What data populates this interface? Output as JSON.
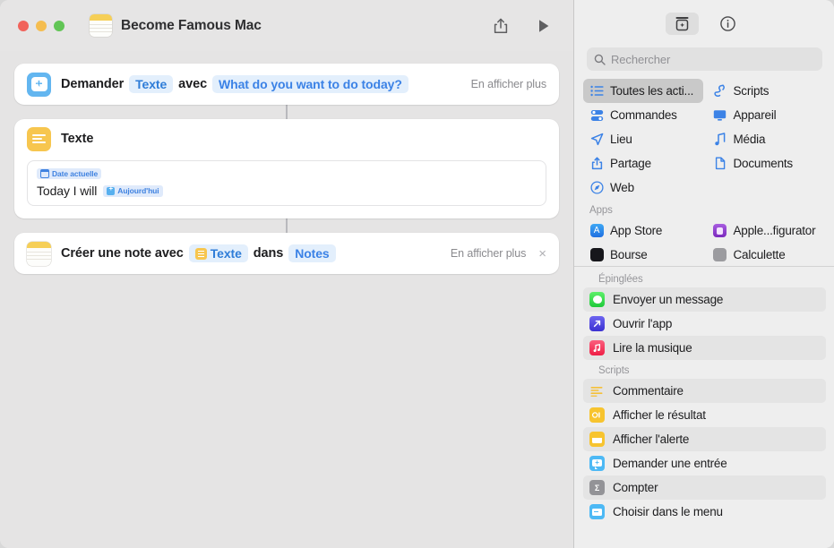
{
  "window": {
    "title": "Become Famous Mac",
    "traffic_lights": [
      "close",
      "minimize",
      "zoom"
    ],
    "doc_icon": "notes-document-icon",
    "share_label": "share-icon",
    "play_label": "play-icon"
  },
  "workflow": {
    "actions": [
      {
        "icon": "ask-for-input-icon",
        "icon_color": "#63b6f0",
        "verb": "Demander",
        "token1": "Texte",
        "mid": "avec",
        "token2": "What do you want to do today?",
        "more_label": "En afficher plus"
      },
      {
        "icon": "text-action-icon",
        "icon_color": "#f7c64f",
        "title": "Texte",
        "field": {
          "badge": "Date actuelle",
          "value": "Today I will",
          "token": "Aujourd'hui"
        }
      },
      {
        "icon": "notes-app-icon",
        "verb": "Créer une note avec",
        "token1": "Texte",
        "mid": "dans",
        "token2": "Notes",
        "more_label": "En afficher plus",
        "close_label": "×"
      }
    ]
  },
  "library": {
    "toolbar": {
      "add_action_icon": "action-library-icon",
      "info_icon": "info-circle-icon"
    },
    "search": {
      "placeholder": "Rechercher",
      "icon": "search-icon"
    },
    "categories": [
      {
        "label": "Toutes les acti...",
        "icon": "list-icon",
        "selected": true
      },
      {
        "label": "Scripts",
        "icon": "scripts-icon",
        "selected": false
      },
      {
        "label": "Commandes",
        "icon": "controls-icon",
        "selected": false
      },
      {
        "label": "Appareil",
        "icon": "device-icon",
        "selected": false
      },
      {
        "label": "Lieu",
        "icon": "location-icon",
        "selected": false
      },
      {
        "label": "Média",
        "icon": "media-icon",
        "selected": false
      },
      {
        "label": "Partage",
        "icon": "share-icon",
        "selected": false
      },
      {
        "label": "Documents",
        "icon": "documents-icon",
        "selected": false
      },
      {
        "label": "Web",
        "icon": "web-icon",
        "selected": false
      }
    ],
    "apps_section": {
      "label": "Apps",
      "items": [
        {
          "label": "App Store",
          "icon": "app-store-icon",
          "color": "#3b8ff0"
        },
        {
          "label": "Apple...figurator",
          "icon": "apple-configurator-icon",
          "color": "#8e43c9"
        },
        {
          "label": "Bourse",
          "icon": "stocks-icon",
          "color": "#1c1c20"
        },
        {
          "label": "Calculette",
          "icon": "calculator-icon",
          "color": "#8a8a8e"
        }
      ]
    },
    "pinned_section": {
      "label": "Épinglées",
      "items": [
        {
          "label": "Envoyer un message",
          "icon": "messages-icon",
          "color": "#3fcf4b"
        },
        {
          "label": "Ouvrir l'app",
          "icon": "open-app-icon",
          "color": "#4f46e5"
        },
        {
          "label": "Lire la musique",
          "icon": "music-icon",
          "color": "#f43f5e"
        }
      ]
    },
    "scripts_section": {
      "label": "Scripts",
      "items": [
        {
          "label": "Commentaire",
          "icon": "comment-icon",
          "color": "#f7c64f"
        },
        {
          "label": "Afficher le résultat",
          "icon": "show-result-icon",
          "color": "#f7c64f"
        },
        {
          "label": "Afficher l'alerte",
          "icon": "show-alert-icon",
          "color": "#f7c64f"
        },
        {
          "label": "Demander une entrée",
          "icon": "ask-input-icon",
          "color": "#4db9f5"
        },
        {
          "label": "Compter",
          "icon": "count-icon",
          "color": "#8a8a8e"
        },
        {
          "label": "Choisir dans le menu",
          "icon": "choose-menu-icon",
          "color": "#4db9f5"
        }
      ]
    }
  }
}
